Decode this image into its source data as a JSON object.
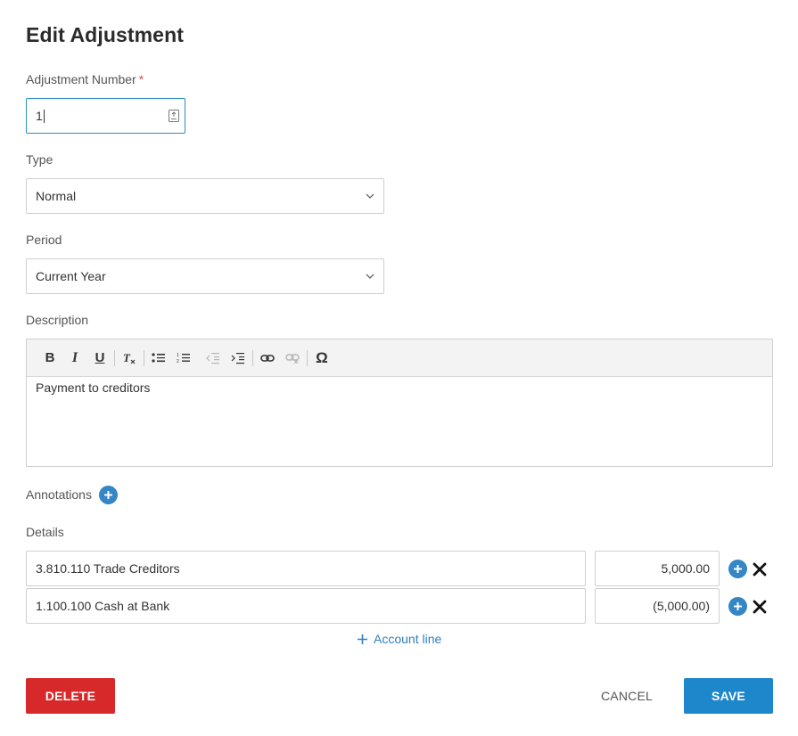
{
  "dialog": {
    "title": "Edit Adjustment"
  },
  "adjustment_number": {
    "label": "Adjustment Number",
    "required_mark": "*",
    "value": "1"
  },
  "type": {
    "label": "Type",
    "value": "Normal"
  },
  "period": {
    "label": "Period",
    "value": "Current Year"
  },
  "description": {
    "label": "Description",
    "toolbar": [
      "bold",
      "italic",
      "underline",
      "remove-format",
      "bulleted-list",
      "numbered-list",
      "decrease-indent",
      "increase-indent",
      "link",
      "unlink",
      "special-character"
    ],
    "text": "Payment to creditors"
  },
  "annotations": {
    "label": "Annotations"
  },
  "details": {
    "label": "Details",
    "lines": [
      {
        "account": "3.810.110 Trade Creditors",
        "amount": "5,000.00"
      },
      {
        "account": "1.100.100 Cash at Bank",
        "amount": "(5,000.00)"
      }
    ],
    "add_line_label": "Account line"
  },
  "actions": {
    "delete": "DELETE",
    "cancel": "CANCEL",
    "save": "SAVE"
  },
  "colors": {
    "accent": "#1e87cc",
    "danger": "#d7282a",
    "link": "#2f7fc0",
    "add_icon": "#3486c4",
    "focus_border": "#2a8fbd"
  }
}
